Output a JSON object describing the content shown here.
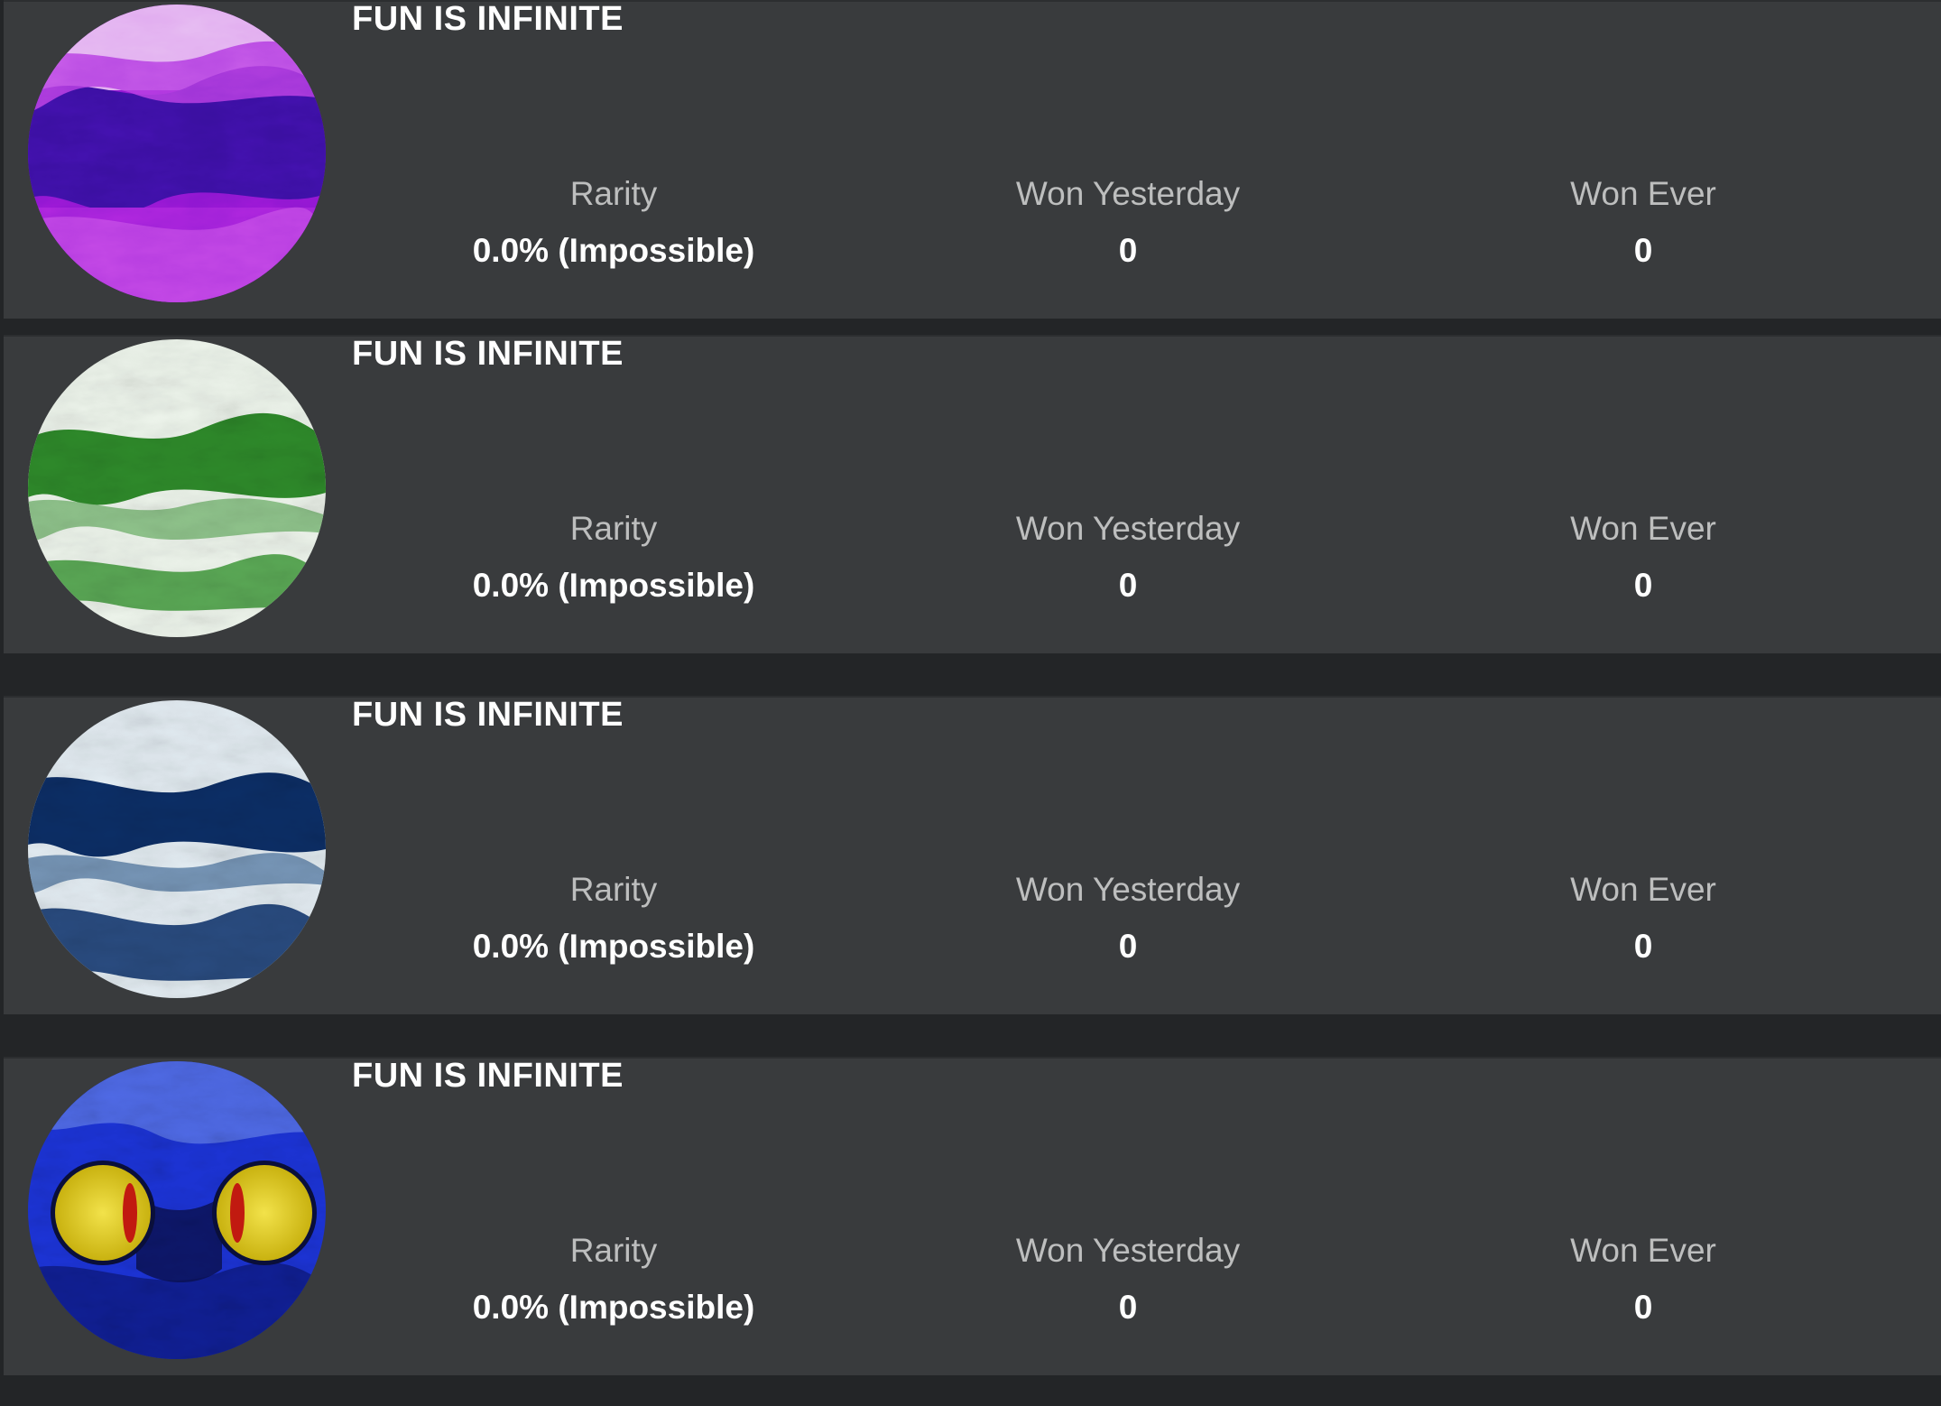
{
  "badges": [
    {
      "title": "FUN IS INFINITE",
      "icon": "purple-cloud-badge-icon",
      "colors": {
        "base": "#7a10c9",
        "dark": "#2b0f8f",
        "light": "#e9b6f2"
      },
      "rarity_label": "Rarity",
      "rarity_value": "0.0% (Impossible)",
      "won_yesterday_label": "Won Yesterday",
      "won_yesterday_value": "0",
      "won_ever_label": "Won Ever",
      "won_ever_value": "0"
    },
    {
      "title": "FUN IS INFINITE",
      "icon": "green-cloud-badge-icon",
      "colors": {
        "base": "#e6f0e4",
        "dark": "#1f7a1c",
        "light": "#f4f9f2"
      },
      "rarity_label": "Rarity",
      "rarity_value": "0.0% (Impossible)",
      "won_yesterday_label": "Won Yesterday",
      "won_yesterday_value": "0",
      "won_ever_label": "Won Ever",
      "won_ever_value": "0"
    },
    {
      "title": "FUN IS INFINITE",
      "icon": "navy-cloud-badge-icon",
      "colors": {
        "base": "#dfe8ef",
        "dark": "#0b2a5e",
        "light": "#f0f5f8"
      },
      "rarity_label": "Rarity",
      "rarity_value": "0.0% (Impossible)",
      "won_yesterday_label": "Won Yesterday",
      "won_yesterday_value": "0",
      "won_ever_label": "Won Ever",
      "won_ever_value": "0"
    },
    {
      "title": "FUN IS INFINITE",
      "icon": "cat-eyes-badge-icon",
      "colors": {
        "base": "#1a2fd6",
        "dark": "#0a0f3a",
        "eye": "#e7d21c",
        "pupil": "#c11a10"
      },
      "rarity_label": "Rarity",
      "rarity_value": "0.0% (Impossible)",
      "won_yesterday_label": "Won Yesterday",
      "won_yesterday_value": "0",
      "won_ever_label": "Won Ever",
      "won_ever_value": "0"
    }
  ]
}
